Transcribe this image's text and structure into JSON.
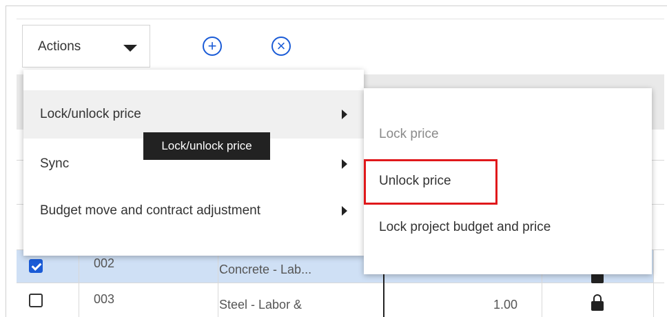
{
  "toolbar": {
    "actions_label": "Actions",
    "add_symbol": "+",
    "remove_symbol": "×"
  },
  "menu": {
    "items": [
      {
        "label": "Lock/unlock price"
      },
      {
        "label": "Sync"
      },
      {
        "label": "Budget move and contract adjustment"
      }
    ]
  },
  "submenu": {
    "items": [
      {
        "label": "Lock price",
        "disabled": true
      },
      {
        "label": "Unlock price",
        "highlighted": true
      },
      {
        "label": "Lock project budget and price"
      }
    ]
  },
  "tooltip": {
    "text": "Lock/unlock price"
  },
  "grid": {
    "rows": [
      {
        "id": "002",
        "description": "Concrete - Lab...",
        "checked": true,
        "value": ""
      },
      {
        "id": "003",
        "description": "Steel - Labor &",
        "checked": false,
        "value": "1.00"
      }
    ]
  },
  "colors": {
    "accent": "#1a5bd6",
    "selected_row": "#cfe0f5",
    "highlight": "#e0181b"
  }
}
